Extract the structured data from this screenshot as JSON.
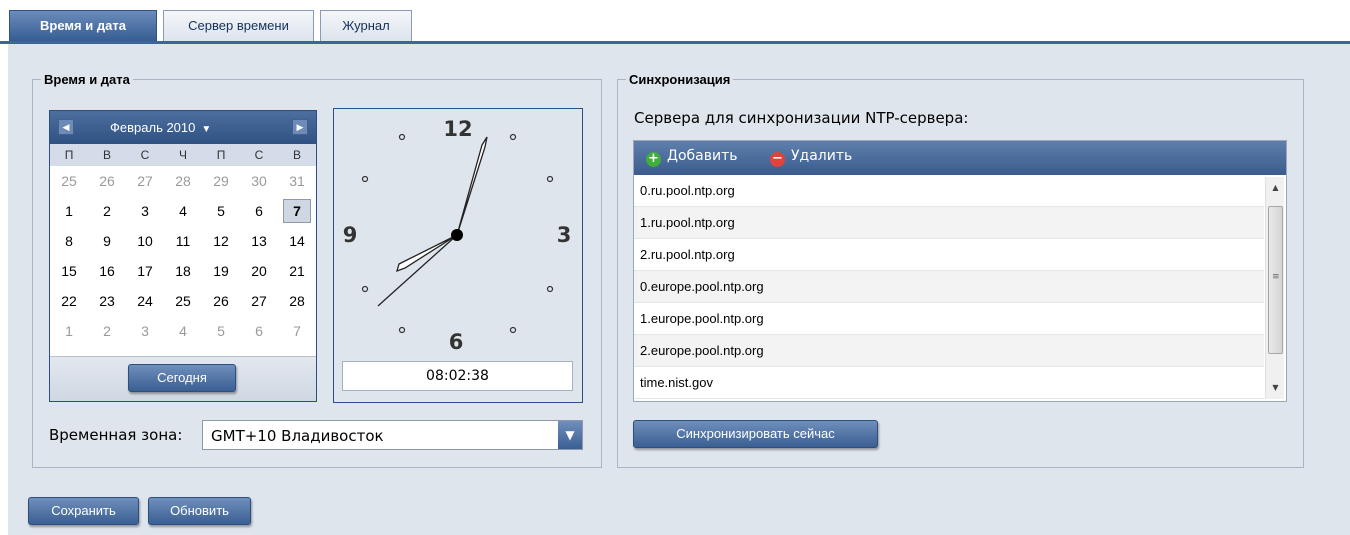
{
  "tabs": [
    {
      "label": "Время и дата",
      "active": true
    },
    {
      "label": "Сервер времени",
      "active": false
    },
    {
      "label": "Журнал",
      "active": false
    }
  ],
  "datetime_group": {
    "legend": "Время и дата"
  },
  "calendar": {
    "month_label": "Февраль 2010",
    "weekdays": [
      "П",
      "В",
      "С",
      "Ч",
      "П",
      "С",
      "В"
    ],
    "weeks": [
      [
        "25",
        "26",
        "27",
        "28",
        "29",
        "30",
        "31"
      ],
      [
        "1",
        "2",
        "3",
        "4",
        "5",
        "6",
        "7"
      ],
      [
        "8",
        "9",
        "10",
        "11",
        "12",
        "13",
        "14"
      ],
      [
        "15",
        "16",
        "17",
        "18",
        "19",
        "20",
        "21"
      ],
      [
        "22",
        "23",
        "24",
        "25",
        "26",
        "27",
        "28"
      ],
      [
        "1",
        "2",
        "3",
        "4",
        "5",
        "6",
        "7"
      ]
    ],
    "today_label": "Сегодня",
    "selected_day": "7"
  },
  "clock": {
    "numerals": {
      "twelve": "12",
      "three": "3",
      "six": "6",
      "nine": "9"
    },
    "time": "08:02:38"
  },
  "timezone": {
    "label": "Временная зона:",
    "value": "GMT+10 Владивосток"
  },
  "sync_group": {
    "legend": "Синхронизация",
    "servers_label": "Сервера для синхронизации NTP-сервера:",
    "add_label": "Добавить",
    "remove_label": "Удалить",
    "servers": [
      "0.ru.pool.ntp.org",
      "1.ru.pool.ntp.org",
      "2.ru.pool.ntp.org",
      "0.europe.pool.ntp.org",
      "1.europe.pool.ntp.org",
      "2.europe.pool.ntp.org",
      "time.nist.gov"
    ],
    "sync_now_label": "Синхронизировать сейчас"
  },
  "footer": {
    "save_label": "Сохранить",
    "refresh_label": "Обновить"
  },
  "colors": {
    "accent": "#3a5f92",
    "panel": "#dfe5ec",
    "add_icon": "#3fae3a",
    "remove_icon": "#e0433b"
  }
}
